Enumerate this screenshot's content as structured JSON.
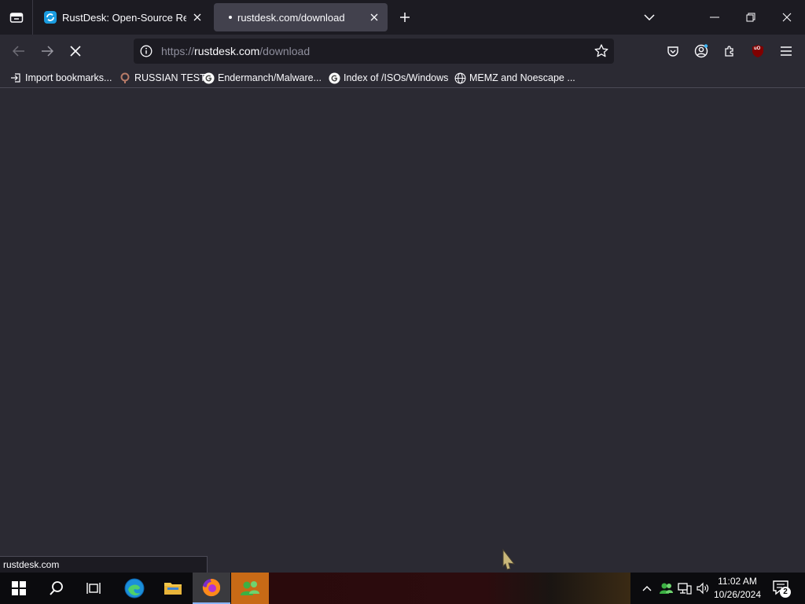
{
  "browser": {
    "tabs": [
      {
        "title": "RustDesk: Open-Source Remote",
        "active": false
      },
      {
        "title": "rustdesk.com/download",
        "active": true,
        "loading": true
      }
    ],
    "url": {
      "scheme": "https://",
      "host": "rustdesk.com",
      "path": "/download"
    },
    "bookmarks": [
      {
        "label": "Import bookmarks...",
        "icon": "import-icon"
      },
      {
        "label": "RUSSIAN TEST",
        "icon": "ring-icon"
      },
      {
        "label": "Endermanch/Malware...",
        "icon": "google-icon"
      },
      {
        "label": "Index of /ISOs/Windows",
        "icon": "google-icon"
      },
      {
        "label": "MEMZ and Noescape ...",
        "icon": "globe-icon"
      }
    ],
    "status_text": "rustdesk.com",
    "ublock_label": "uO"
  },
  "taskbar": {
    "clock_time": "11:02 AM",
    "clock_date": "10/26/2024",
    "notification_count": "2"
  },
  "colors": {
    "accent": "#8ab4f8",
    "page_bg": "#2b2a33",
    "chrome_bg": "#1c1b22",
    "active_tab_bg": "#42414d"
  }
}
